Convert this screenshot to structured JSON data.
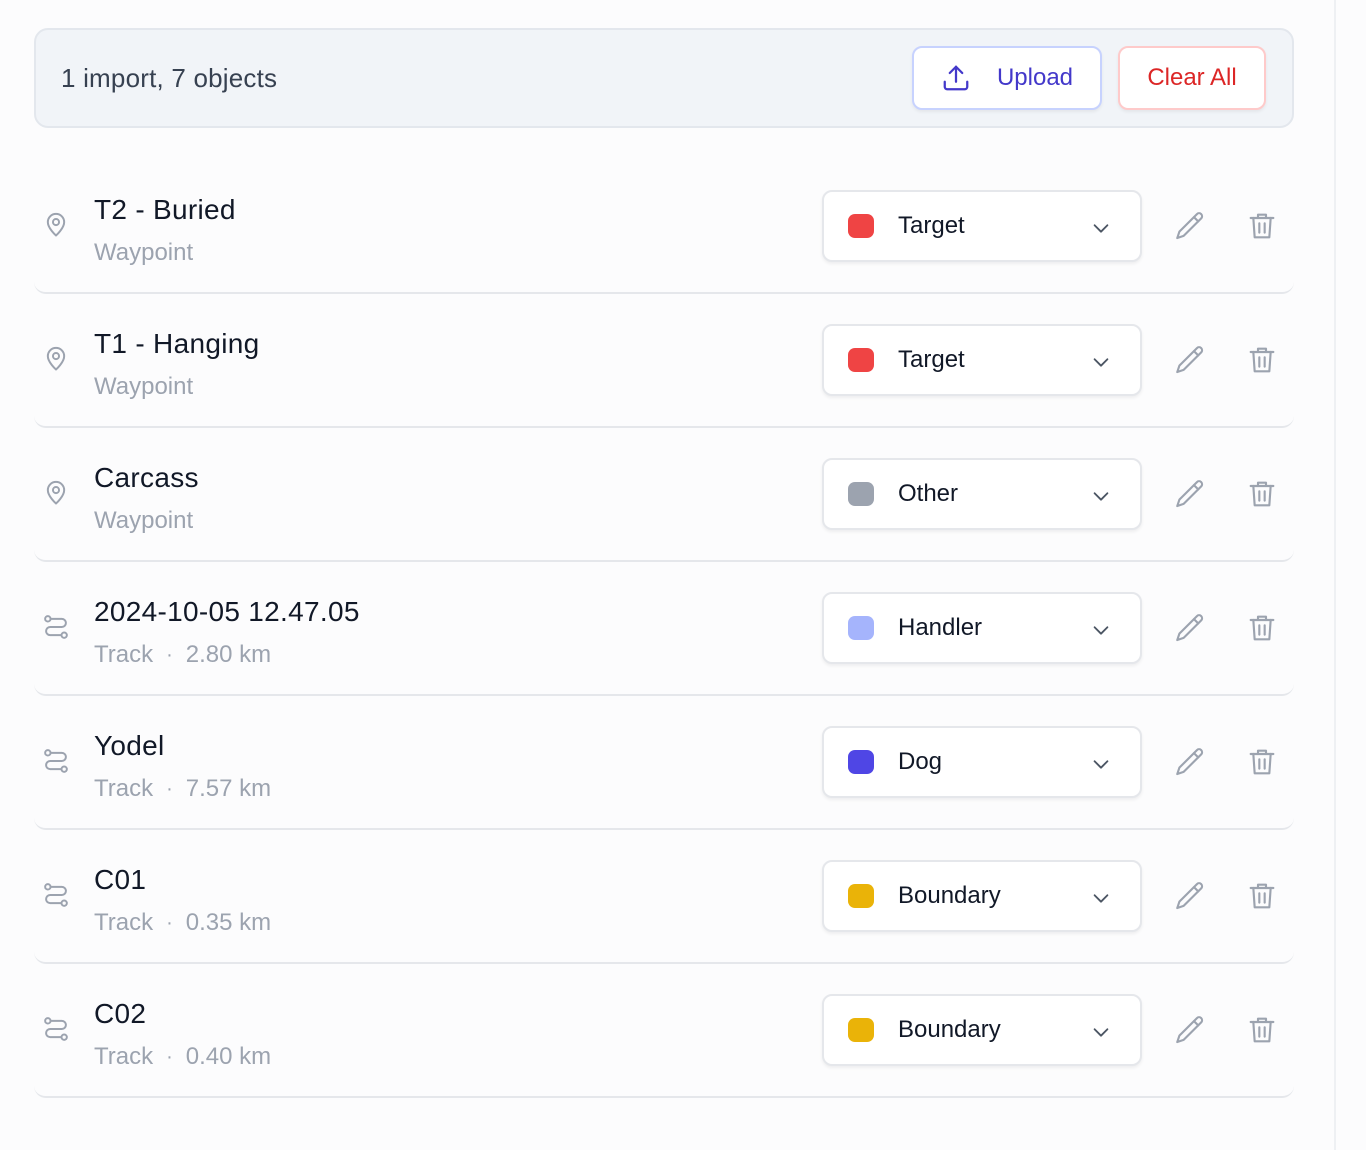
{
  "summary": {
    "text": "1 import, 7 objects",
    "upload_label": "Upload",
    "upload_icon": "upload-icon",
    "clear_label": "Clear All"
  },
  "colors": {
    "target": "#ef4444",
    "other": "#9ca3af",
    "handler": "#a5b4fc",
    "dog": "#4f46e5",
    "boundary": "#eab308",
    "accent": "#4338ca",
    "danger": "#dc2626"
  },
  "items": [
    {
      "title": "T2 - Buried",
      "type": "Waypoint",
      "distance": "",
      "icon": "map-pin-icon",
      "category": "Target",
      "color": "#ef4444"
    },
    {
      "title": "T1 - Hanging",
      "type": "Waypoint",
      "distance": "",
      "icon": "map-pin-icon",
      "category": "Target",
      "color": "#ef4444"
    },
    {
      "title": "Carcass",
      "type": "Waypoint",
      "distance": "",
      "icon": "map-pin-icon",
      "category": "Other",
      "color": "#9ca3af"
    },
    {
      "title": "2024-10-05 12.47.05",
      "type": "Track",
      "distance": "2.80 km",
      "icon": "route-icon",
      "category": "Handler",
      "color": "#a5b4fc"
    },
    {
      "title": "Yodel",
      "type": "Track",
      "distance": "7.57 km",
      "icon": "route-icon",
      "category": "Dog",
      "color": "#4f46e5"
    },
    {
      "title": "C01",
      "type": "Track",
      "distance": "0.35 km",
      "icon": "route-icon",
      "category": "Boundary",
      "color": "#eab308"
    },
    {
      "title": "C02",
      "type": "Track",
      "distance": "0.40 km",
      "icon": "route-icon",
      "category": "Boundary",
      "color": "#eab308"
    }
  ]
}
